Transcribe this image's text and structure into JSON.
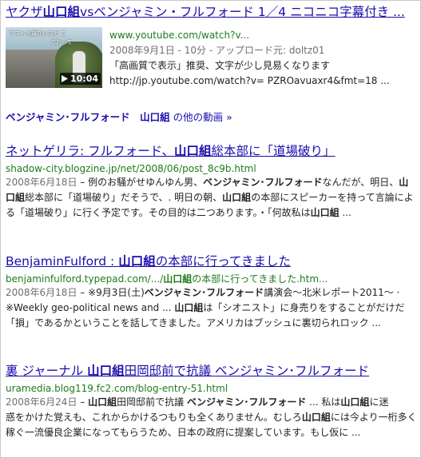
{
  "video_result": {
    "title_pre": "ヤクザ",
    "title_bold": "山口組",
    "title_post": "vsベンジャミン・フルフォード 1／4 ニコニコ字幕付き ...",
    "url": "www.youtube.com/watch?v...",
    "meta": "2008年9月1日 - 10分 - アップロード元: doltz01",
    "snippet1": "「高画質で表示」推奨、文字が少し見易くなります",
    "snippet2": "http://jp.youtube.com/watch?v= PZROavuaxr4&fmt=18 ...",
    "thumb_caption_1": "ワストも撮ないなど こ",
    "thumb_caption_2": "これって",
    "duration": "10:04",
    "more_videos": {
      "query_1": "ベンジャミン･フルフォード",
      "query_2": "山口組",
      "suffix": " の他の動画 »"
    }
  },
  "results": [
    {
      "title_parts": [
        {
          "t": "ネットゲリラ: フルフォード、",
          "b": false
        },
        {
          "t": "山口組",
          "b": true
        },
        {
          "t": "総本部に「道場破り」",
          "b": false
        }
      ],
      "url": "shadow-city.blogzine.jp/net/2008/06/post_8c9b.html",
      "date": "2008年6月18日",
      "lines": [
        [
          {
            "t": " – 例のお騒がせゆんゆん男、",
            "b": false
          },
          {
            "t": "ベンジャミン･フルフォード",
            "b": true
          },
          {
            "t": "なんだが、明日、",
            "b": false
          },
          {
            "t": "山",
            "b": true
          }
        ],
        [
          {
            "t": "口組",
            "b": true
          },
          {
            "t": "総本部に「道場破り」だそうで、. 明日の朝、",
            "b": false
          },
          {
            "t": "山口組",
            "b": true
          },
          {
            "t": "の本部にスピーカーを持って言論によ",
            "b": false
          }
        ],
        [
          {
            "t": "る「道場破り」に行く予定です。その目的は二つあります。・「何故私は",
            "b": false
          },
          {
            "t": "山口組",
            "b": true
          },
          {
            "t": " ...",
            "b": false
          }
        ]
      ]
    },
    {
      "title_parts": [
        {
          "t": "BenjaminFulford : ",
          "b": false
        },
        {
          "t": "山口組",
          "b": true
        },
        {
          "t": "の本部に行ってきました",
          "b": false
        }
      ],
      "url_parts": [
        {
          "t": "benjaminfulford.typepad.com/.../",
          "b": false
        },
        {
          "t": "山口組",
          "b": true
        },
        {
          "t": "の本部に行ってきました.htm...",
          "b": false
        }
      ],
      "date": "2008年6月18日",
      "lines": [
        [
          {
            "t": " – ※9月3日(土)",
            "b": false
          },
          {
            "t": "ベンジャミン･フルフォード",
            "b": true
          },
          {
            "t": "講演会～北米レポート2011～ ·",
            "b": false
          }
        ],
        [
          {
            "t": "※Weekly geo-political news and ... ",
            "b": false
          },
          {
            "t": "山口組",
            "b": true
          },
          {
            "t": "は「シオニスト」に身売りをすることがだけだ",
            "b": false
          }
        ],
        [
          {
            "t": "「損」であるかということを話してきました。アメリカはブッシュに裏切られロック ...",
            "b": false
          }
        ]
      ]
    },
    {
      "title_parts": [
        {
          "t": "裏 ジャーナル ",
          "b": false
        },
        {
          "t": "山口組",
          "b": true
        },
        {
          "t": "田岡邸前で抗議 ",
          "b": false
        },
        {
          "t": "ベンジャミン･フルフォード",
          "b": false
        }
      ],
      "url": "uramedia.blog119.fc2.com/blog-entry-51.html",
      "date": "2008年6月24日",
      "lines": [
        [
          {
            "t": " – ",
            "b": false
          },
          {
            "t": "山口組",
            "b": true
          },
          {
            "t": "田岡邸前で抗議 ",
            "b": false
          },
          {
            "t": "ベンジャミン･フルフォード",
            "b": true
          },
          {
            "t": " ... 私は",
            "b": false
          },
          {
            "t": "山口組",
            "b": true
          },
          {
            "t": "に迷",
            "b": false
          }
        ],
        [
          {
            "t": "惑をかけた覚えも、これからかけるつもりも全くありません。むしろ",
            "b": false
          },
          {
            "t": "山口組",
            "b": true
          },
          {
            "t": "には今より一桁多く",
            "b": false
          }
        ],
        [
          {
            "t": "稼ぐ一流優良企業になってもらうため、日本の政府に提案しています。もし仮に ...",
            "b": false
          }
        ]
      ]
    }
  ],
  "colors": {
    "link": "#1a0dab",
    "url": "#1e7b1e",
    "date": "#6f6f6f",
    "text": "#222222"
  }
}
